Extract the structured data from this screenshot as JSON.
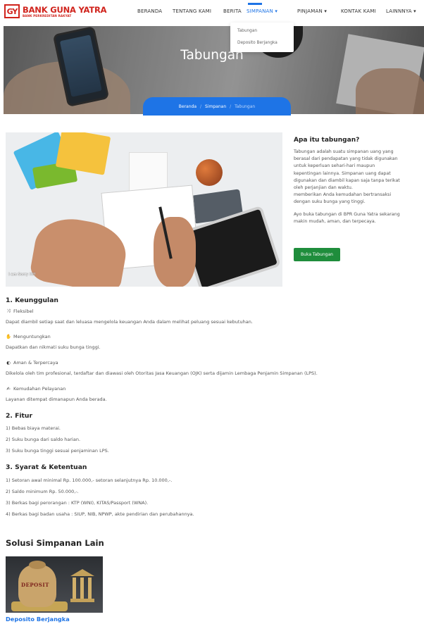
{
  "brand": {
    "mark": "GY",
    "name": "BANK GUNA YATRA",
    "sub": "BANK PERKREDITAN RAKYAT",
    "color": "#d0231c"
  },
  "nav": {
    "items": [
      {
        "label": "BERANDA"
      },
      {
        "label": "TENTANG KAMI"
      },
      {
        "label": "BERITA"
      },
      {
        "label": "SIMPANAN ▾",
        "active": true
      },
      {
        "label": "PINJAMAN ▾"
      },
      {
        "label": "KONTAK KAMI"
      },
      {
        "label": "LAINNNYA ▾"
      }
    ],
    "dropdown": [
      "Tabungan",
      "Deposito Berjangka"
    ]
  },
  "hero": {
    "title": "Tabungan",
    "breadcrumb": [
      "Beranda",
      "Simpanan",
      "Tabungan"
    ]
  },
  "intro": {
    "image_caption": "I am Sorry !!!!",
    "heading": "Apa itu tabungan?",
    "p1_lines": [
      "Tabungan adalah suatu simpanan uang yang",
      "berasal dari pendapatan yang tidak digunakan",
      "untuk keperluan sehari-hari maupun",
      "kepentingan lainnya. Simpanan uang dapat",
      "digunakan dan diambil kapan saja tanpa terikat",
      "oleh perjanjian dan waktu.",
      "memberikan Anda kemudahan bertransaksi",
      "dengan suku bunga yang tinggi."
    ],
    "p2_lines": [
      "Ayo buka tabungan di BPR Guna Yatra sekarang",
      "makin mudah, aman, dan terpecaya."
    ],
    "button": "Buka Tabungan",
    "button_color": "#1f8d3c"
  },
  "keunggulan": {
    "title": "1. Keunggulan",
    "items": [
      {
        "icon": "shuffle-icon",
        "title": "Fleksibel",
        "desc": "Dapat diambil setiap saat dan leluasa mengelola keuangan Anda dalam melihat peluang sesuai kebutuhan."
      },
      {
        "icon": "hand-coin-icon",
        "title": "Menguntungkan",
        "desc": "Dapatkan dan nikmati suku bunga tinggi."
      },
      {
        "icon": "shield-icon",
        "title": "Aman & Terpercaya",
        "desc": "Dikelola oleh tim profesional, terdaftar dan diawasi oleh Otoritas Jasa Keuangan (OJK) serta dijamin Lembaga Penjamin Simpanan (LPS)."
      },
      {
        "icon": "handshake-icon",
        "title": "Kemudahan Pelayanan",
        "desc": "Layanan ditempat dimanapun Anda berada."
      }
    ]
  },
  "fitur": {
    "title": "2. Fitur",
    "items": [
      "1) Bebas biaya materai.",
      "2) Suku bunga dari saldo harian.",
      "3) Suku bunga tinggi sesuai penjaminan LPS."
    ]
  },
  "syarat": {
    "title": "3. Syarat & Ketentuan",
    "items": [
      "1) Setoran awal minimal Rp. 100.000,- setoran selanjutnya Rp. 10.000,-.",
      "2) Saldo minimum Rp. 50.000,-.",
      "3) Berkas bagi perorangan : KTP (WNI), KITAS/Passport (WNA).",
      "4) Berkas bagi badan usaha : SIUP, NIB, NPWP, akte pendirian dan perubahannya."
    ]
  },
  "other": {
    "title": "Solusi Simpanan Lain",
    "card_image_label": "DEPOSIT",
    "card_caption": "Deposito Berjangka",
    "link_color": "#1e74e6"
  }
}
